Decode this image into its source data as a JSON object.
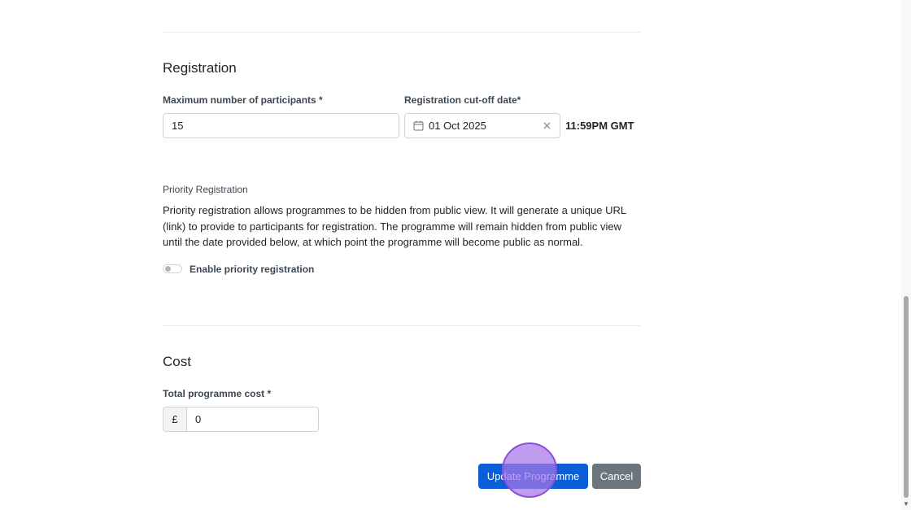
{
  "registration": {
    "title": "Registration",
    "max_participants_label": "Maximum number of participants *",
    "max_participants_value": "15",
    "cutoff_label": "Registration cut-off date*",
    "cutoff_value": "01 Oct 2025",
    "cutoff_time": "11:59PM GMT",
    "calendar_icon": "calendar-icon",
    "clear_icon": "close-icon"
  },
  "priority": {
    "label": "Priority Registration",
    "description": "Priority registration allows programmes to be hidden from public view. It will generate a unique URL (link) to provide to participants for registration. The programme will remain hidden from public view until the date provided below, at which point the programme will become public as normal.",
    "toggle_label": "Enable priority registration",
    "toggle_on": false
  },
  "cost": {
    "title": "Cost",
    "total_label": "Total programme cost *",
    "currency_symbol": "£",
    "total_value": "0"
  },
  "actions": {
    "update_label": "Update Programme",
    "cancel_label": "Cancel"
  },
  "colors": {
    "primary": "#0b5ed7",
    "secondary": "#6c757d",
    "click_indicator": "#a876e8"
  }
}
